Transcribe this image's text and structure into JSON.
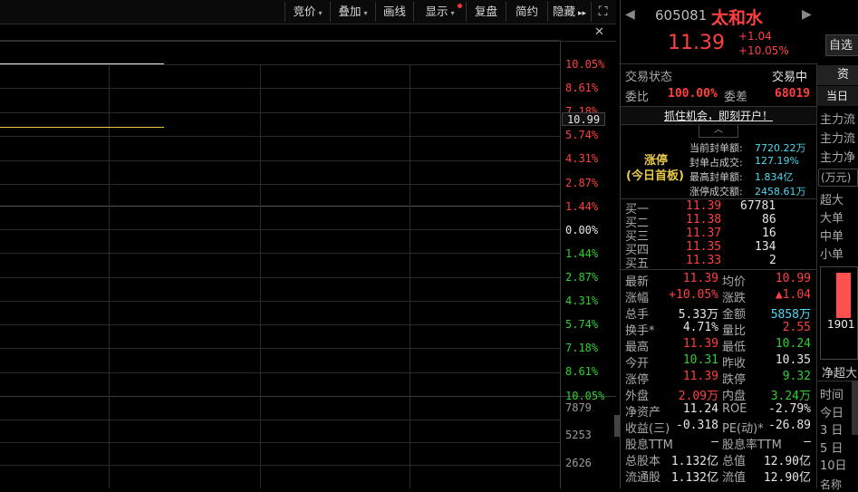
{
  "toolbar": {
    "items": [
      {
        "label": "竞价",
        "caret": "▾"
      },
      {
        "label": "叠加",
        "caret": "▾"
      },
      {
        "label": "画线",
        "caret": ""
      },
      {
        "label": "显示",
        "caret": "▾"
      },
      {
        "label": "复盘",
        "caret": ""
      },
      {
        "label": "简约",
        "caret": ""
      },
      {
        "label": "隐藏",
        "caret": "▸▸"
      }
    ],
    "expand_icon": "⛶",
    "close_icon": "✕"
  },
  "chart": {
    "pct_labels_up": [
      "10.05%",
      "8.61%",
      "7.18%",
      "5.74%",
      "4.31%",
      "2.87%",
      "1.44%"
    ],
    "zero_label": "0.00%",
    "pct_labels_down": [
      "1.44%",
      "2.87%",
      "4.31%",
      "5.74%",
      "7.18%",
      "8.61%",
      "10.05%"
    ],
    "current_price": "10.99",
    "volume_labels": [
      "7879",
      "5253",
      "2626"
    ]
  },
  "stock": {
    "code": "605081",
    "name": "太和水",
    "price": "11.39",
    "change": "+1.04",
    "change_pct": "+10.05%",
    "watch_button": "自选",
    "prev_icon": "◀",
    "next_icon": "▶"
  },
  "status": {
    "label": "交易状态",
    "value": "交易中",
    "weibi_label": "委比",
    "weibi": "100.00%",
    "weicha_label": "委差",
    "weicha": "68019",
    "banner": "抓住机会，即刻开户！"
  },
  "limit": {
    "badge1": "涨停",
    "badge2": "(今日首板)",
    "rows": [
      {
        "label": "当前封单额:",
        "value": "7720.22万"
      },
      {
        "label": "封单占成交:",
        "value": "127.19%"
      },
      {
        "label": "最高封单额:",
        "value": "1.834亿"
      },
      {
        "label": "涨停成交额:",
        "value": "2458.61万"
      }
    ]
  },
  "book": [
    {
      "label": "买一",
      "price": "11.39",
      "vol": "67781"
    },
    {
      "label": "买二",
      "price": "11.38",
      "vol": "86"
    },
    {
      "label": "买三",
      "price": "11.37",
      "vol": "16"
    },
    {
      "label": "买四",
      "price": "11.35",
      "vol": "134"
    },
    {
      "label": "买五",
      "price": "11.33",
      "vol": "2"
    }
  ],
  "quote": [
    {
      "l1": "最新",
      "v1": "11.39",
      "c1": "r",
      "l2": "均价",
      "v2": "10.99",
      "c2": "r"
    },
    {
      "l1": "涨幅",
      "v1": "+10.05%",
      "c1": "r",
      "l2": "涨跌",
      "v2": "▲1.04",
      "c2": "r"
    },
    {
      "l1": "总手",
      "v1": "5.33万",
      "c1": "w",
      "l2": "金额",
      "v2": "5858万",
      "c2": "c"
    },
    {
      "l1": "换手*",
      "v1": "4.71%",
      "c1": "w",
      "l2": "量比",
      "v2": "2.55",
      "c2": "r"
    },
    {
      "l1": "最高",
      "v1": "11.39",
      "c1": "r",
      "l2": "最低",
      "v2": "10.24",
      "c2": "g"
    },
    {
      "l1": "今开",
      "v1": "10.31",
      "c1": "g",
      "l2": "昨收",
      "v2": "10.35",
      "c2": "w"
    },
    {
      "l1": "涨停",
      "v1": "11.39",
      "c1": "r",
      "l2": "跌停",
      "v2": "9.32",
      "c2": "g"
    },
    {
      "l1": "外盘",
      "v1": "2.09万",
      "c1": "r",
      "l2": "内盘",
      "v2": "3.24万",
      "c2": "g"
    },
    {
      "l1": "净资产",
      "v1": "11.24",
      "c1": "w",
      "l2": "ROE",
      "v2": "-2.79%",
      "c2": "w"
    },
    {
      "l1": "收益(三)",
      "v1": "-0.318",
      "c1": "w",
      "l2": "PE(动)*",
      "v2": "-26.89",
      "c2": "w"
    },
    {
      "l1": "股息TTM",
      "v1": "—",
      "c1": "w",
      "l2": "股息率TTM",
      "v2": "—",
      "c2": "w"
    },
    {
      "l1": "总股本",
      "v1": "1.132亿",
      "c1": "w",
      "l2": "总值",
      "v2": "12.90亿",
      "c2": "w"
    },
    {
      "l1": "流通股",
      "v1": "1.132亿",
      "c1": "w",
      "l2": "流值",
      "v2": "12.90亿",
      "c2": "w"
    }
  ],
  "capital": {
    "tab": "资金",
    "today_tab": "当日",
    "rows": [
      "主力流",
      "主力流",
      "主力净"
    ],
    "unit": "(万元)",
    "sizes": [
      "超大",
      "大单",
      "中单",
      "小单"
    ],
    "bar_value": "1901",
    "net_label": "净超大",
    "time_header": "时间",
    "periods": [
      "今日",
      "3 日",
      "5 日",
      "10日"
    ],
    "bottom": "名称"
  }
}
